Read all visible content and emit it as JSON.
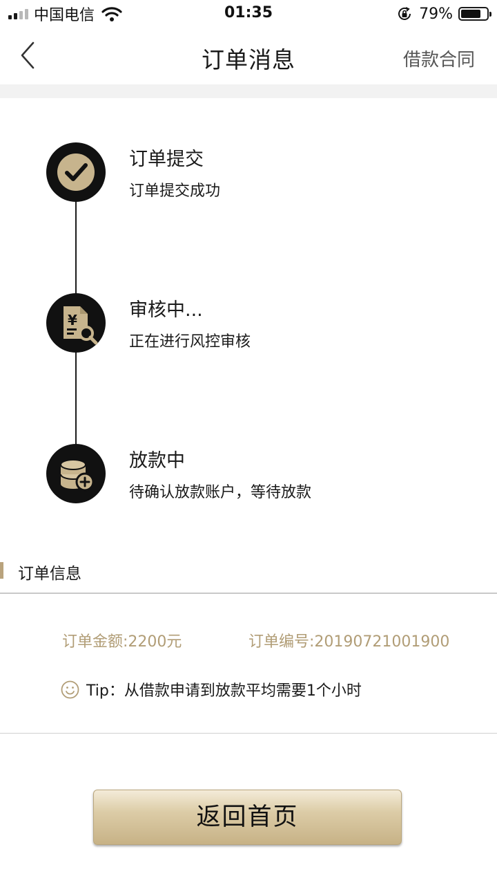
{
  "status_bar": {
    "carrier": "中国电信",
    "time": "01:35",
    "battery": "79%",
    "battery_level": 0.79
  },
  "nav": {
    "title": "订单消息",
    "right_link": "借款合同",
    "back_icon": "chevron-left-icon"
  },
  "timeline": {
    "steps": [
      {
        "title": "订单提交",
        "desc": "订单提交成功",
        "icon": "check-icon"
      },
      {
        "title": "审核中...",
        "desc": "正在进行风控审核",
        "icon": "document-search-icon"
      },
      {
        "title": "放款中",
        "desc": "待确认放款账户，等待放款",
        "icon": "coins-add-icon"
      }
    ]
  },
  "order_info": {
    "section_title": "订单信息",
    "amount": "订单金额:2200元",
    "order_no": "订单编号:20190721001900",
    "tip": "Tip：从借款申请到放款平均需要1个小时"
  },
  "actions": {
    "home_button": "返回首页"
  },
  "colors": {
    "accent_gold": "#b9a37d",
    "gold_text": "#b19d76",
    "dark": "#111111"
  }
}
